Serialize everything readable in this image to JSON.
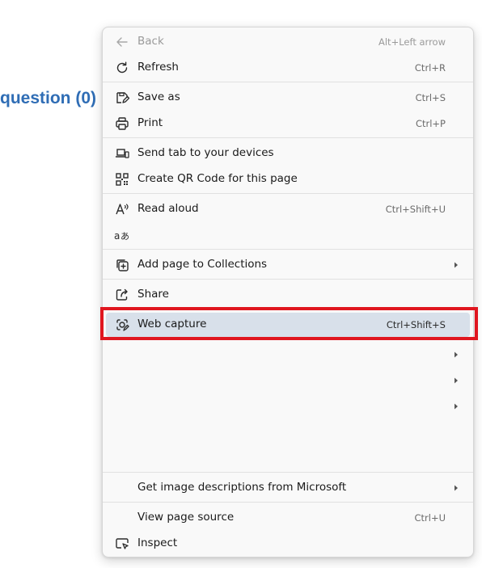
{
  "background": {
    "link_text": "question (0)"
  },
  "context_menu": {
    "items": [
      {
        "label": "Back",
        "shortcut": "Alt+Left arrow",
        "icon": "arrow-left-icon",
        "disabled": true
      },
      {
        "label": "Refresh",
        "shortcut": "Ctrl+R",
        "icon": "refresh-icon"
      },
      {
        "label": "Save as",
        "shortcut": "Ctrl+S",
        "icon": "save-as-icon"
      },
      {
        "label": "Print",
        "shortcut": "Ctrl+P",
        "icon": "printer-icon"
      },
      {
        "label": "Send tab to your devices",
        "shortcut": "",
        "icon": "devices-icon"
      },
      {
        "label": "Create QR Code for this page",
        "shortcut": "",
        "icon": "qr-code-icon"
      },
      {
        "label": "Read aloud",
        "shortcut": "Ctrl+Shift+U",
        "icon": "read-aloud-icon"
      },
      {
        "label": "",
        "shortcut": "",
        "icon": "translate-icon"
      },
      {
        "label": "Add page to Collections",
        "shortcut": "",
        "icon": "collections-icon",
        "submenu": true
      },
      {
        "label": "Share",
        "shortcut": "",
        "icon": "share-icon"
      },
      {
        "label": "Web capture",
        "shortcut": "Ctrl+Shift+S",
        "icon": "web-capture-icon",
        "highlighted": true
      },
      {
        "label": "",
        "shortcut": "",
        "submenu": true
      },
      {
        "label": "",
        "shortcut": "",
        "submenu": true
      },
      {
        "label": "",
        "shortcut": "",
        "submenu": true
      },
      {
        "label": "Get image descriptions from Microsoft",
        "shortcut": "",
        "submenu": true
      },
      {
        "label": "View page source",
        "shortcut": "Ctrl+U"
      },
      {
        "label": "Inspect",
        "shortcut": "",
        "icon": "inspect-icon"
      }
    ]
  },
  "annotation": {
    "highlight_color": "#e0161f",
    "highlighted_item": "Web capture"
  },
  "colors": {
    "menu_background": "#f9f9f9",
    "hover_background": "#d8e0ea",
    "link_color": "#2f6db5"
  }
}
